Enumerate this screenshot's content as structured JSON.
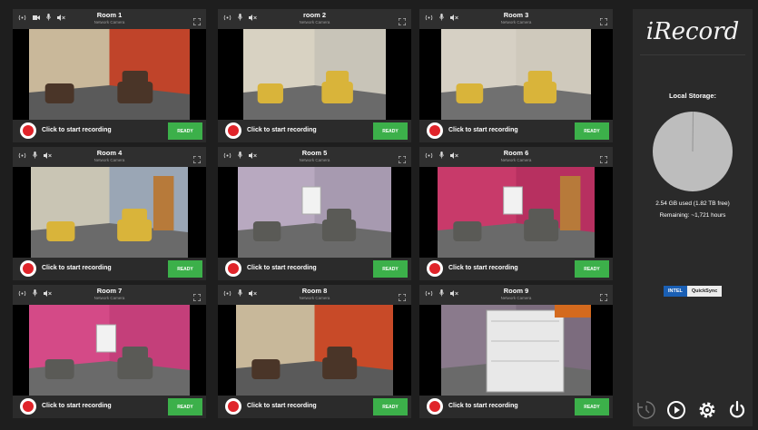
{
  "app": {
    "name": "iRecord"
  },
  "rooms": [
    {
      "name": "Room 1",
      "type": "Network Camera",
      "record_label": "Click to start recording",
      "status": "READY"
    },
    {
      "name": "room 2",
      "type": "Network Camera",
      "record_label": "Click to start recording",
      "status": "READY"
    },
    {
      "name": "Room 3",
      "type": "Network Camera",
      "record_label": "Click to start recording",
      "status": "READY"
    },
    {
      "name": "Room 4",
      "type": "Network Camera",
      "record_label": "Click to start recording",
      "status": "READY"
    },
    {
      "name": "Room 5",
      "type": "Network Camera",
      "record_label": "Click to start recording",
      "status": "READY"
    },
    {
      "name": "Room 6",
      "type": "Network Camera",
      "record_label": "Click to start recording",
      "status": "READY"
    },
    {
      "name": "Room 7",
      "type": "Network Camera",
      "record_label": "Click to start recording",
      "status": "READY"
    },
    {
      "name": "Room 8",
      "type": "Network Camera",
      "record_label": "Click to start recording",
      "status": "READY"
    },
    {
      "name": "Room 9",
      "type": "Network Camera",
      "record_label": "Click to start recording",
      "status": "READY"
    }
  ],
  "sidebar": {
    "storage_title": "Local Storage:",
    "storage_used": "2.54 GB used (1.82 TB free)",
    "storage_remaining": "Remaining: ~1,721 hours",
    "used_fraction": 0.0014,
    "hw_vendor": "INTEL",
    "hw_engine": "QuickSync",
    "icons": [
      "clock-icon",
      "play-icon",
      "settings-gear-icon",
      "power-icon"
    ]
  },
  "colors": {
    "accent_ready": "#3cb04a",
    "record_red": "#e0242a",
    "background": "#1e1e1e",
    "panel": "#2b2b2b",
    "intel_blue": "#1a5fb4"
  }
}
